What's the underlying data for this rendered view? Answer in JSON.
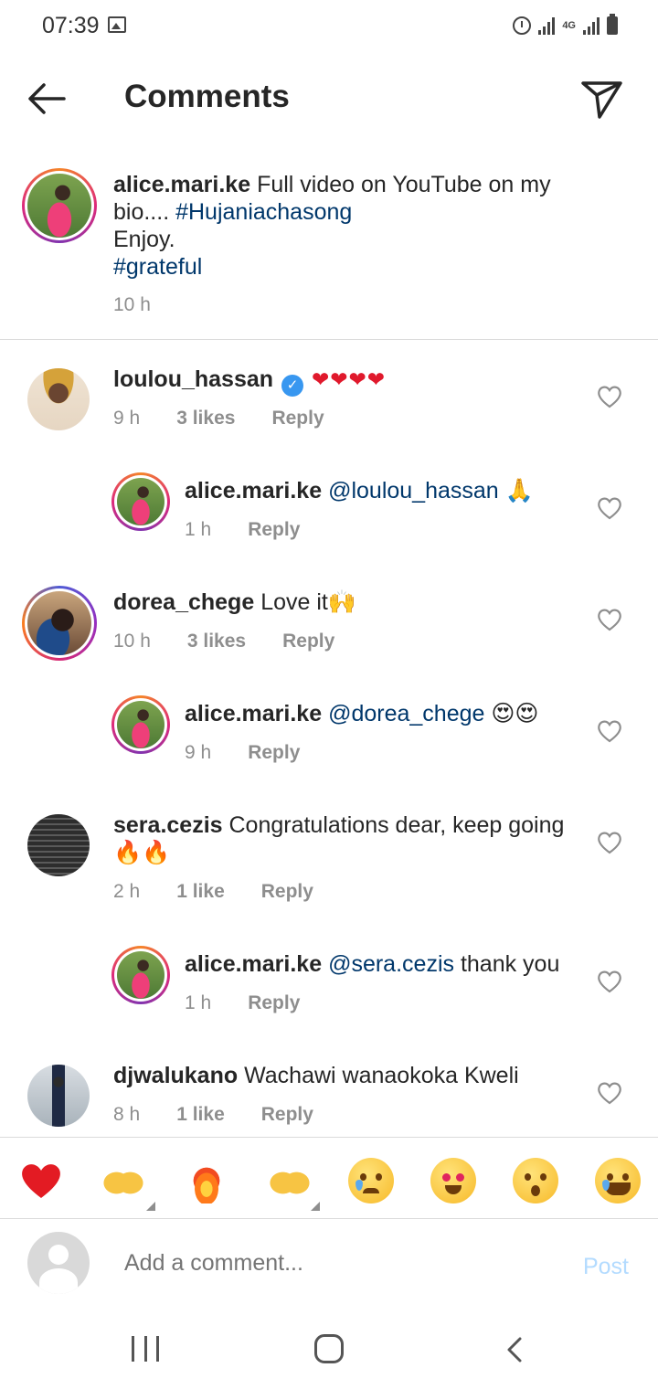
{
  "status_bar": {
    "time": "07:39",
    "network": "4G"
  },
  "header": {
    "title": "Comments"
  },
  "caption": {
    "username": "alice.mari.ke",
    "text_before": " Full video on YouTube on my bio.... ",
    "hashtag1": "#Hujaniachasong",
    "line2": "Enjoy.",
    "hashtag2": "#grateful",
    "time": "10 h"
  },
  "comments": [
    {
      "username": "loulou_hassan",
      "text": "❤❤❤❤",
      "time": "9 h",
      "likes": "3 likes",
      "reply": "Reply"
    },
    {
      "username": "alice.mari.ke",
      "mention": "@loulou_hassan",
      "text": " 🙏",
      "time": "1 h",
      "reply": "Reply"
    },
    {
      "username": "dorea_chege",
      "text": " Love it🙌",
      "time": "10 h",
      "likes": "3 likes",
      "reply": "Reply"
    },
    {
      "username": "alice.mari.ke",
      "mention": "@dorea_chege",
      "text": " 😍😍",
      "time": "9 h",
      "reply": "Reply"
    },
    {
      "username": "sera.cezis",
      "text": " Congratulations dear, keep going",
      "text2": "🔥🔥",
      "time": "2 h",
      "likes": "1 like",
      "reply": "Reply"
    },
    {
      "username": "alice.mari.ke",
      "mention": "@sera.cezis",
      "text": " thank you",
      "time": "1 h",
      "reply": "Reply"
    },
    {
      "username": "djwalukano",
      "text": " Wachawi wanaokoka Kweli",
      "time": "8 h",
      "likes": "1 like",
      "reply": "Reply"
    }
  ],
  "emoji_bar": [
    "red-heart",
    "raising-hands",
    "fire",
    "clapping-hands",
    "crying-face",
    "heart-eyes-face",
    "surprised-face",
    "laughing-face"
  ],
  "composer": {
    "placeholder": "Add a comment...",
    "post_label": "Post"
  },
  "colors": {
    "link": "#00376b",
    "verified": "#3897f0",
    "post_disabled": "#b3dbff",
    "muted": "#8e8e8e"
  }
}
